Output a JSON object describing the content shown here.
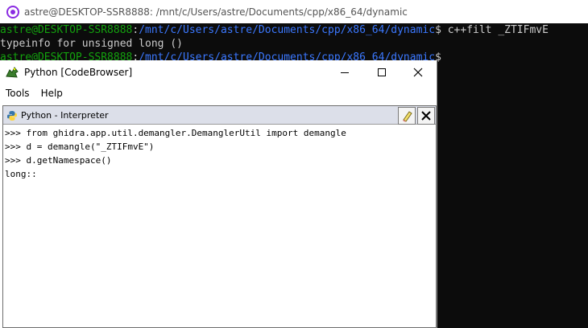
{
  "terminal": {
    "title": "astre@DESKTOP-SSR8888: /mnt/c/Users/astre/Documents/cpp/x86_64/dynamic",
    "lines": [
      {
        "user": "astre@DESKTOP-SSR8888",
        "sep": ":",
        "path": "/mnt/c/Users/astre/Documents/cpp/x86_64/dynamic",
        "prompt": "$ ",
        "cmd": "c++filt _ZTIFmvE"
      },
      {
        "output": "typeinfo for unsigned long ()"
      },
      {
        "user": "astre@DESKTOP-SSR8888",
        "sep": ":",
        "path": "/mnt/c/Users/astre/Documents/cpp/x86_64/dynamic",
        "prompt": "$",
        "cmd": ""
      }
    ]
  },
  "ghidra": {
    "title": "Python [CodeBrowser]",
    "menu": [
      "Tools",
      "Help"
    ],
    "panel_title": "Python - Interpreter",
    "console_lines": [
      ">>> from ghidra.app.util.demangler.DemanglerUtil import demangle",
      ">>> d = demangle(\"_ZTIFmvE\")",
      ">>> d.getNamespace()",
      "long::"
    ]
  },
  "colors": {
    "terminal_bg": "#0c0c0c",
    "user_green": "#13a10e",
    "path_blue": "#3b78ff",
    "text_gray": "#cccccc",
    "panel_header": "#dcdfe9"
  },
  "icons": [
    "terminal-penguin-icon",
    "ghidra-dragon-icon",
    "minimize-icon",
    "maximize-icon",
    "close-icon",
    "python-icon",
    "clear-eraser-icon",
    "close-panel-icon"
  ]
}
